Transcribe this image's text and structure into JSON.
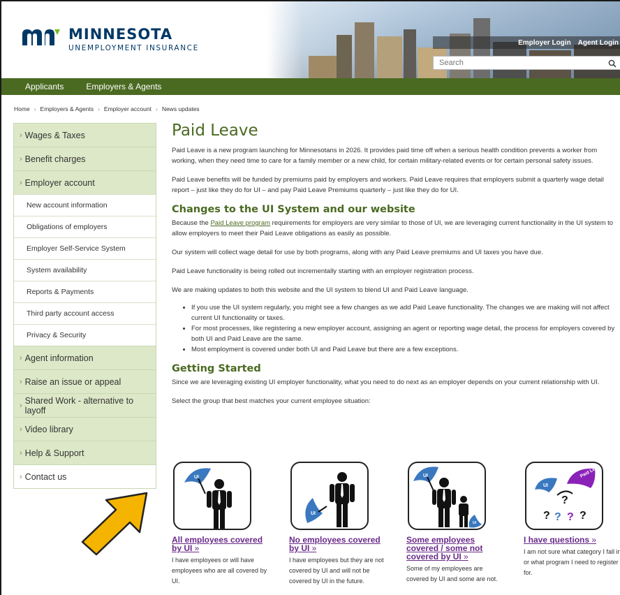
{
  "brand": {
    "name": "MINNESOTA",
    "subtitle": "UNEMPLOYMENT INSURANCE"
  },
  "header": {
    "employer_login": "Employer Login",
    "agent_login": "Agent Login",
    "search_placeholder": "Search"
  },
  "nav": {
    "items": [
      "Applicants",
      "Employers & Agents"
    ]
  },
  "breadcrumb": [
    "Home",
    "Employers & Agents",
    "Employer account",
    "News updates"
  ],
  "sidebar": {
    "wages_taxes": "Wages & Taxes",
    "benefit_charges": "Benefit charges",
    "employer_account": "Employer account",
    "sub": [
      "New account information",
      "Obligations of employers",
      "Employer Self-Service System",
      "System availability",
      "Reports & Payments",
      "Third party account access",
      "Privacy & Security"
    ],
    "agent_information": "Agent information",
    "raise_issue": "Raise an issue or appeal",
    "shared_work": "Shared Work - alternative to layoff",
    "video_library": "Video library",
    "help_support": "Help & Support",
    "contact_us": "Contact us"
  },
  "content": {
    "title": "Paid Leave",
    "p1": "Paid Leave is a new program launching for Minnesotans in 2026. It provides paid time off when a serious health condition prevents a worker from working, when they need time to care for a family member or a new child, for certain military-related events or for certain personal safety issues.",
    "p2": "Paid Leave benefits will be funded by premiums paid by employers and workers. Paid Leave requires that employers submit a quarterly wage detail report – just like they do for UI – and pay Paid Leave Premiums quarterly – just like they do for UI.",
    "h_changes": "Changes to the UI System and our website",
    "p3_before": "Because the ",
    "p3_link": "Paid Leave program",
    "p3_after": " requirements for employers are very similar to those of UI, we are leveraging current functionality in the UI system to allow employers to meet their Paid Leave obligations as easily as possible.",
    "p4": "Our system will collect wage detail for use by both programs, along with any Paid Leave premiums and UI taxes you have due.",
    "p5": "Paid Leave functionality is being rolled out incrementally starting with an employer registration process.",
    "p6": "We are making updates to both this website and the UI system to blend UI and Paid Leave language.",
    "bullets": [
      "If you use the UI system regularly, you might see a few changes as we add Paid Leave functionality. The changes we are making will not affect current UI functionality or taxes.",
      "For most processes, like registering a new employer account, assigning an agent or reporting wage detail, the process for employers covered by both UI and Paid Leave are the same.",
      "Most employment is covered under both UI and Paid Leave but there are a few exceptions."
    ],
    "h_started": "Getting Started",
    "p7": "Since we are leveraging existing UI employer functionality, what you need to do next as an employer depends on your current relationship with UI.",
    "p8": "Select the group that best matches your current employee situation:"
  },
  "cards": [
    {
      "link": "All employees covered by UI",
      "desc": "I have employees or will have employees who are all covered by UI."
    },
    {
      "link": "No employees covered by UI",
      "desc": "I have employees but they are not covered by UI and will not be covered by UI in the future."
    },
    {
      "link": "Some employees covered / some not covered by UI",
      "desc": "Some of my employees are covered by UI and some are not."
    },
    {
      "link": "I have questions",
      "desc": "I am not sure what category I fall in or what program I need to register for."
    }
  ],
  "icon_text": {
    "ui": "UI",
    "paid_leave": "Paid Leave",
    "question": "?"
  },
  "colors": {
    "brand_green": "#4a6a21",
    "sidebar_green": "#dde8c8",
    "link_purple": "#6a2a8a",
    "umbrella_blue": "#3a78c0",
    "arrow_yellow": "#f4b400"
  }
}
